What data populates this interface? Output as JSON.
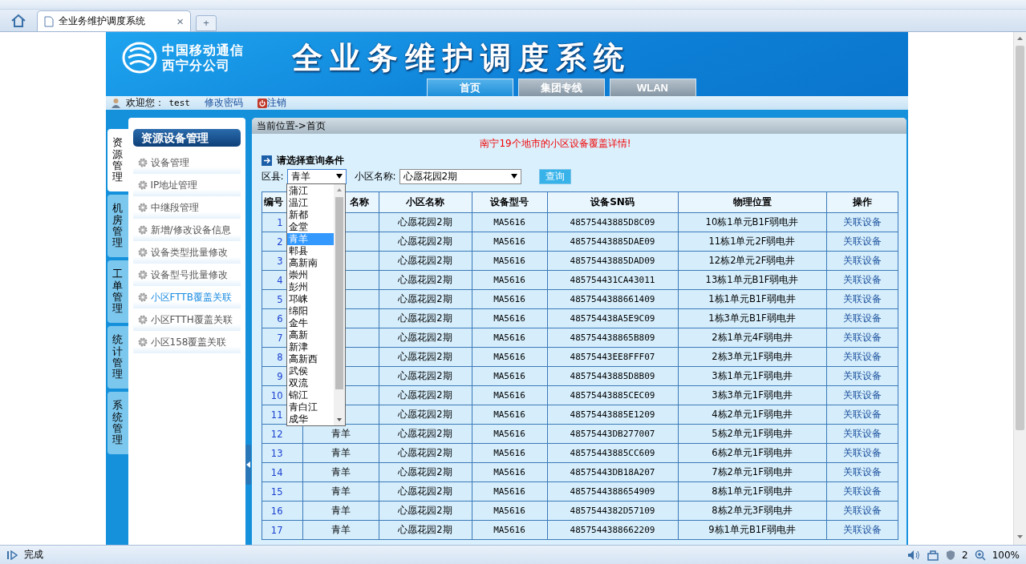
{
  "browser": {
    "tab_title": "全业务维护调度系统",
    "close": "×",
    "new_tab": "+"
  },
  "header": {
    "company": [
      "中国移动通信",
      "西宁分公司"
    ],
    "title": "全业务维护调度系统",
    "nav_tabs": [
      {
        "label": "首页",
        "selected": true
      },
      {
        "label": "集团专线",
        "selected": false
      },
      {
        "label": "WLAN",
        "selected": false
      }
    ]
  },
  "welcome": {
    "greeting": "欢迎您：",
    "user": "test",
    "change_password": "修改密码",
    "logout": "注销"
  },
  "side_tabs": [
    {
      "label": "资源管理",
      "selected": true
    },
    {
      "label": "机房管理",
      "selected": false
    },
    {
      "label": "工单管理",
      "selected": false
    },
    {
      "label": "统计管理",
      "selected": false
    },
    {
      "label": "系统管理",
      "selected": false
    }
  ],
  "nav": {
    "title": "资源设备管理",
    "items": [
      {
        "label": "设备管理",
        "selected": false
      },
      {
        "label": "IP地址管理",
        "selected": false
      },
      {
        "label": "中继段管理",
        "selected": false
      },
      {
        "label": "新增/修改设备信息",
        "selected": false
      },
      {
        "label": "设备类型批量修改",
        "selected": false
      },
      {
        "label": "设备型号批量修改",
        "selected": false
      },
      {
        "label": "小区FTTB覆盖关联",
        "selected": true
      },
      {
        "label": "小区FTTH覆盖关联",
        "selected": false
      },
      {
        "label": "小区158覆盖关联",
        "selected": false
      }
    ]
  },
  "breadcrumb": "当前位置->首页",
  "notice": "南宁19个地市的小区设备覆盖详情!",
  "query": {
    "heading": "请选择查询条件",
    "district_label": "区县:",
    "district_value": "青羊",
    "community_label": "小区名称:",
    "community_value": "心愿花园2期",
    "button": "查询"
  },
  "district_options": [
    {
      "label": "蒲江",
      "selected": false
    },
    {
      "label": "温江",
      "selected": false
    },
    {
      "label": "新都",
      "selected": false
    },
    {
      "label": "金堂",
      "selected": false
    },
    {
      "label": "青羊",
      "selected": true
    },
    {
      "label": "郫县",
      "selected": false
    },
    {
      "label": "高新南",
      "selected": false
    },
    {
      "label": "崇州",
      "selected": false
    },
    {
      "label": "彭州",
      "selected": false
    },
    {
      "label": "邛崃",
      "selected": false
    },
    {
      "label": "绵阳",
      "selected": false
    },
    {
      "label": "金牛",
      "selected": false
    },
    {
      "label": "高新",
      "selected": false
    },
    {
      "label": "新津",
      "selected": false
    },
    {
      "label": "高新西",
      "selected": false
    },
    {
      "label": "武侯",
      "selected": false
    },
    {
      "label": "双流",
      "selected": false
    },
    {
      "label": "锦江",
      "selected": false
    },
    {
      "label": "青白江",
      "selected": false
    },
    {
      "label": "成华",
      "selected": false
    }
  ],
  "table": {
    "columns": [
      "编号",
      "名称",
      "小区名称",
      "设备型号",
      "设备SN码",
      "物理位置",
      "操作"
    ],
    "rows": [
      {
        "no": "1",
        "community": "心愿花园2期",
        "model": "MA5616",
        "sn": "48575443885D8C09",
        "location": "10栋1单元B1F弱电井",
        "action": "关联设备"
      },
      {
        "no": "2",
        "community": "心愿花园2期",
        "model": "MA5616",
        "sn": "48575443885DAE09",
        "location": "11栋1单元2F弱电井",
        "action": "关联设备"
      },
      {
        "no": "3",
        "community": "心愿花园2期",
        "model": "MA5616",
        "sn": "48575443885DAD09",
        "location": "12栋2单元2F弱电井",
        "action": "关联设备"
      },
      {
        "no": "4",
        "community": "心愿花园2期",
        "model": "MA5616",
        "sn": "485754431CA43011",
        "location": "13栋1单元B1F弱电井",
        "action": "关联设备"
      },
      {
        "no": "5",
        "community": "心愿花园2期",
        "model": "MA5616",
        "sn": "4857544388661409",
        "location": "1栋1单元B1F弱电井",
        "action": "关联设备"
      },
      {
        "no": "6",
        "community": "心愿花园2期",
        "model": "MA5616",
        "sn": "485754438A5E9C09",
        "location": "1栋3单元B1F弱电井",
        "action": "关联设备"
      },
      {
        "no": "7",
        "community": "心愿花园2期",
        "model": "MA5616",
        "sn": "485754438865B809",
        "location": "2栋1单元4F弱电井",
        "action": "关联设备"
      },
      {
        "no": "8",
        "community": "心愿花园2期",
        "model": "MA5616",
        "sn": "48575443EE8FFF07",
        "location": "2栋3单元1F弱电井",
        "action": "关联设备"
      },
      {
        "no": "9",
        "community": "心愿花园2期",
        "model": "MA5616",
        "sn": "48575443885D8B09",
        "location": "3栋1单元1F弱电井",
        "action": "关联设备"
      },
      {
        "no": "10",
        "community": "心愿花园2期",
        "model": "MA5616",
        "sn": "48575443885CEC09",
        "location": "3栋3单元1F弱电井",
        "action": "关联设备"
      },
      {
        "no": "11",
        "community": "心愿花园2期",
        "model": "MA5616",
        "sn": "48575443885E1209",
        "location": "4栋2单元1F弱电井",
        "action": "关联设备"
      },
      {
        "no": "12",
        "district": "青羊",
        "community": "心愿花园2期",
        "model": "MA5616",
        "sn": "48575443DB277007",
        "location": "5栋2单元1F弱电井",
        "action": "关联设备"
      },
      {
        "no": "13",
        "district": "青羊",
        "community": "心愿花园2期",
        "model": "MA5616",
        "sn": "48575443885CC609",
        "location": "6栋2单元1F弱电井",
        "action": "关联设备"
      },
      {
        "no": "14",
        "district": "青羊",
        "community": "心愿花园2期",
        "model": "MA5616",
        "sn": "48575443DB18A207",
        "location": "7栋2单元1F弱电井",
        "action": "关联设备"
      },
      {
        "no": "15",
        "district": "青羊",
        "community": "心愿花园2期",
        "model": "MA5616",
        "sn": "4857544388654909",
        "location": "8栋1单元1F弱电井",
        "action": "关联设备"
      },
      {
        "no": "16",
        "district": "青羊",
        "community": "心愿花园2期",
        "model": "MA5616",
        "sn": "4857544382D57109",
        "location": "8栋2单元3F弱电井",
        "action": "关联设备"
      },
      {
        "no": "17",
        "district": "青羊",
        "community": "心愿花园2期",
        "model": "MA5616",
        "sn": "4857544388662209",
        "location": "9栋1单元B1F弱电井",
        "action": "关联设备"
      }
    ]
  },
  "status_bar": {
    "text": "完成",
    "count": "2",
    "zoom": "100%"
  }
}
